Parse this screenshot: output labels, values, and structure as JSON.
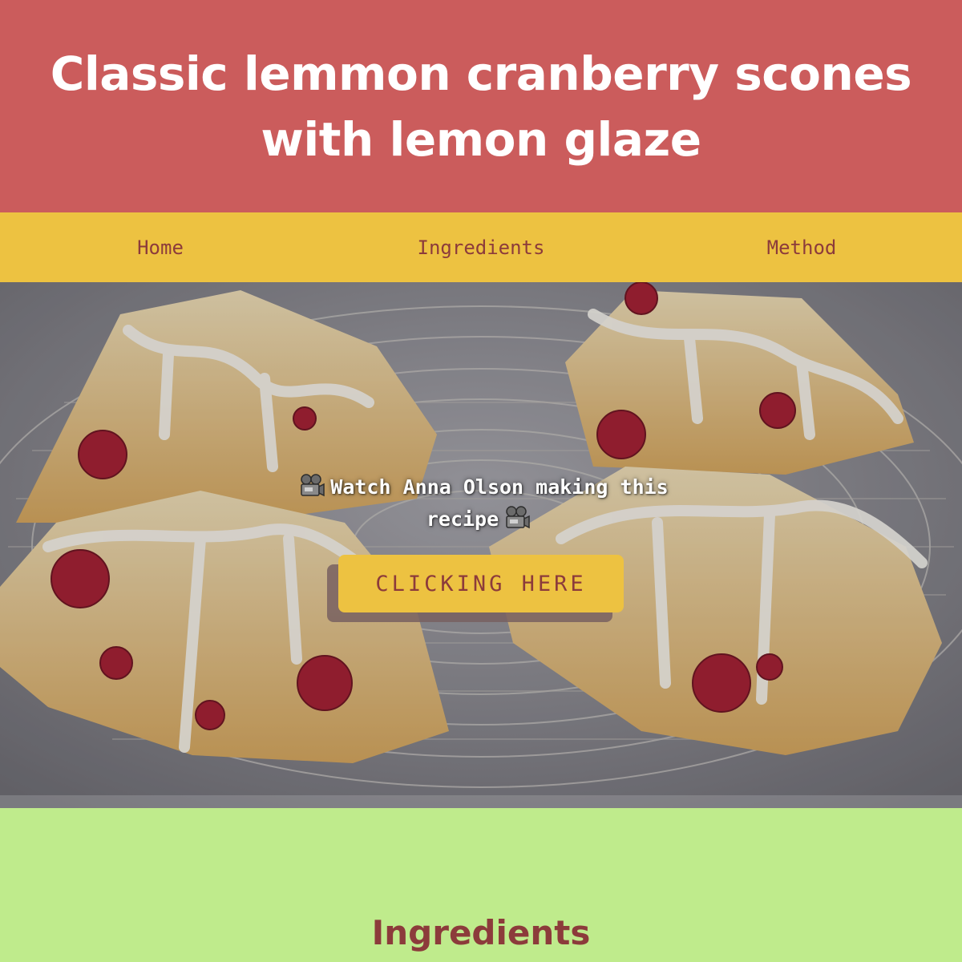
{
  "header": {
    "title": "Classic lemmon cranberry scones with lemon glaze"
  },
  "nav": {
    "items": [
      {
        "label": "Home"
      },
      {
        "label": "Ingredients"
      },
      {
        "label": "Method"
      }
    ]
  },
  "hero": {
    "text_part1": "Watch Anna Olson making this",
    "text_part2": "recipe",
    "button_label": "CLICKING HERE",
    "icon": "film-camera-icon"
  },
  "ingredients": {
    "heading": "Ingredients"
  },
  "colors": {
    "header_bg": "#cb5c5c",
    "nav_bg": "#edc241",
    "accent_text": "#8c3b3b",
    "section_bg": "#bfeb8c"
  }
}
